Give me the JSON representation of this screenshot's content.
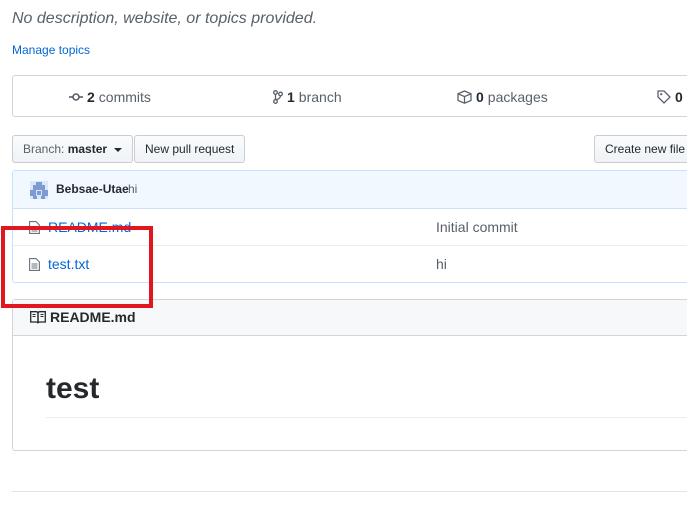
{
  "repo": {
    "description": "No description, website, or topics provided.",
    "manage_topics": "Manage topics"
  },
  "stats": {
    "commits_count": "2",
    "commits_label": "commits",
    "branch_count": "1",
    "branch_label": "branch",
    "packages_count": "0",
    "packages_label": "packages",
    "tags_count": "0"
  },
  "toolbar": {
    "branch_prefix": "Branch:",
    "branch_name": "master",
    "new_pull_request": "New pull request",
    "create_new_file": "Create new file"
  },
  "latest_commit": {
    "author": "Bebsae-Utae",
    "message": "hi"
  },
  "files": [
    {
      "name": "README.md",
      "commit_message": "Initial commit"
    },
    {
      "name": "test.txt",
      "commit_message": "hi"
    }
  ],
  "readme": {
    "title": "README.md",
    "heading": "test"
  },
  "colors": {
    "link": "#0366d6",
    "highlight": "#e0171f",
    "commit_bar": "#f1f8ff"
  }
}
